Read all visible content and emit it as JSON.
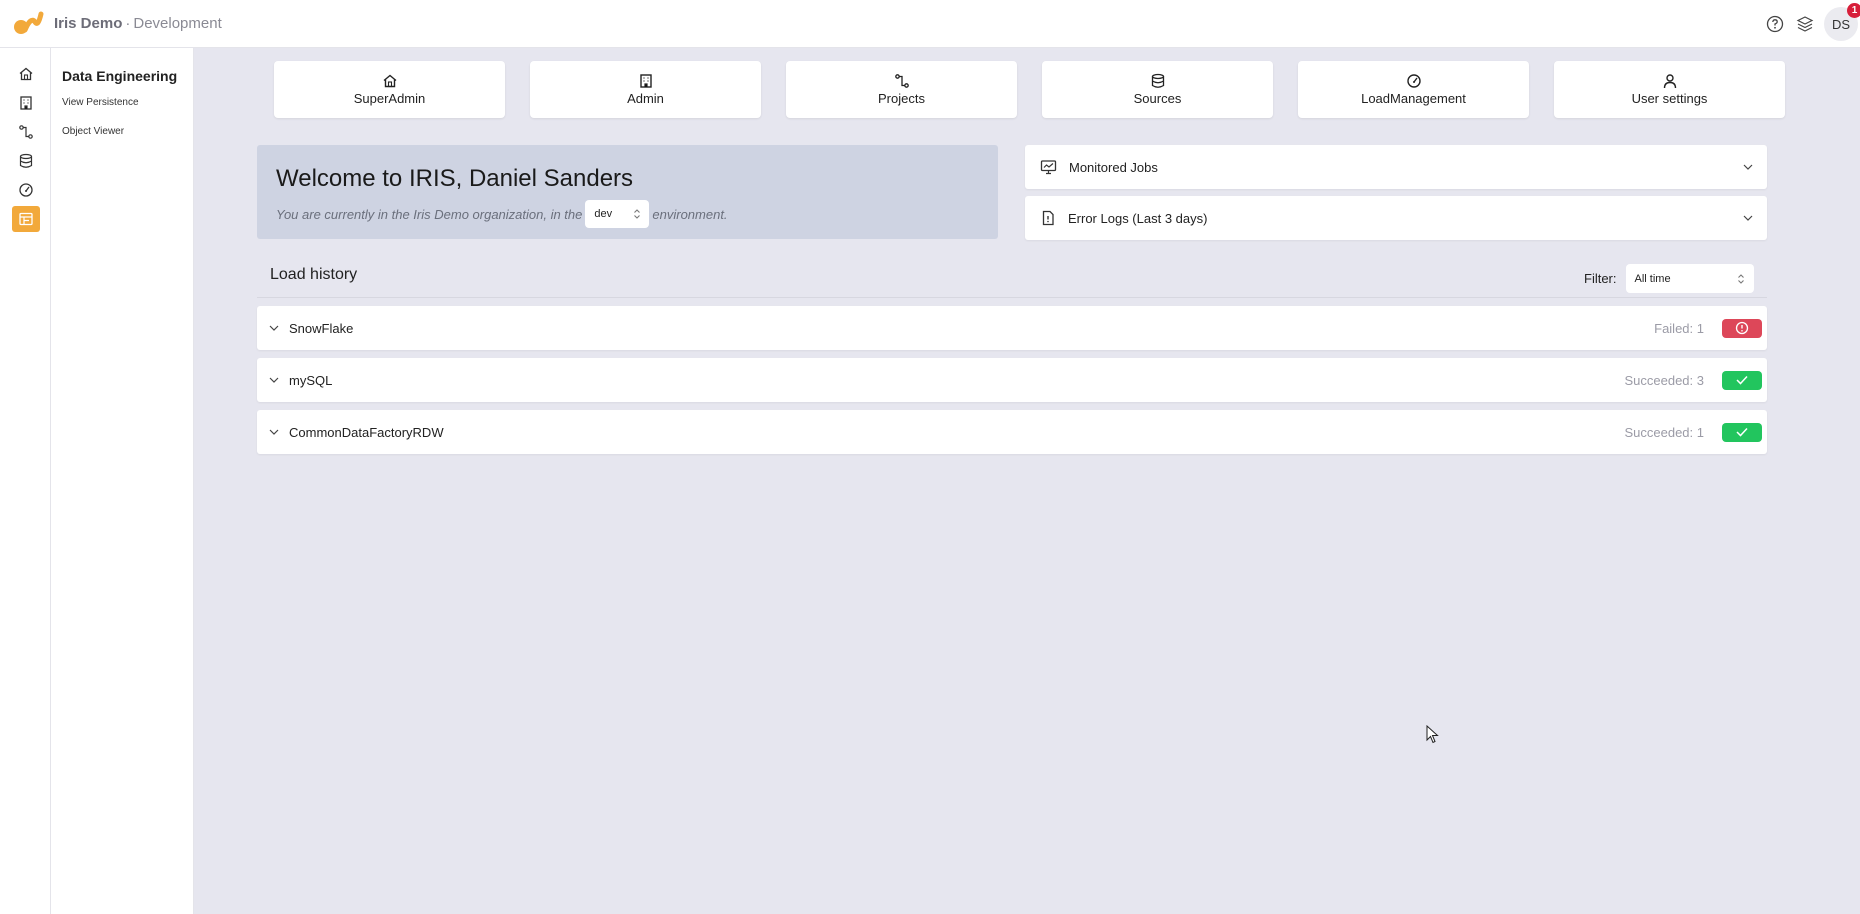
{
  "header": {
    "org": "Iris Demo",
    "separator": "·",
    "environment_name": "Development",
    "avatar_initials": "DS",
    "notification_count": "1"
  },
  "sidebar": {
    "title": "Data Engineering",
    "links": [
      "View Persistence",
      "Object Viewer"
    ]
  },
  "quick_nav": [
    {
      "label": "SuperAdmin",
      "icon": "home-icon"
    },
    {
      "label": "Admin",
      "icon": "building-icon"
    },
    {
      "label": "Projects",
      "icon": "workflow-icon"
    },
    {
      "label": "Sources",
      "icon": "database-icon"
    },
    {
      "label": "LoadManagement",
      "icon": "gauge-icon"
    },
    {
      "label": "User settings",
      "icon": "user-icon"
    }
  ],
  "welcome": {
    "title": "Welcome to IRIS, Daniel Sanders",
    "before": "You are currently in the Iris Demo organization, in the",
    "env_value": "dev",
    "after": "environment."
  },
  "panels": {
    "monitored_jobs": "Monitored Jobs",
    "error_logs": "Error Logs (Last 3 days)"
  },
  "load_history": {
    "title": "Load history",
    "filter_label": "Filter:",
    "filter_value": "All time",
    "rows": [
      {
        "name": "SnowFlake",
        "status": "Failed: 1",
        "state": "failed"
      },
      {
        "name": "mySQL",
        "status": "Succeeded: 3",
        "state": "succeeded"
      },
      {
        "name": "CommonDataFactoryRDW",
        "status": "Succeeded: 1",
        "state": "succeeded"
      }
    ]
  },
  "colors": {
    "accent": "#f2a93b",
    "failed": "#dd4759",
    "succeeded": "#22c55e",
    "welcome_bg": "#ced3e2"
  }
}
